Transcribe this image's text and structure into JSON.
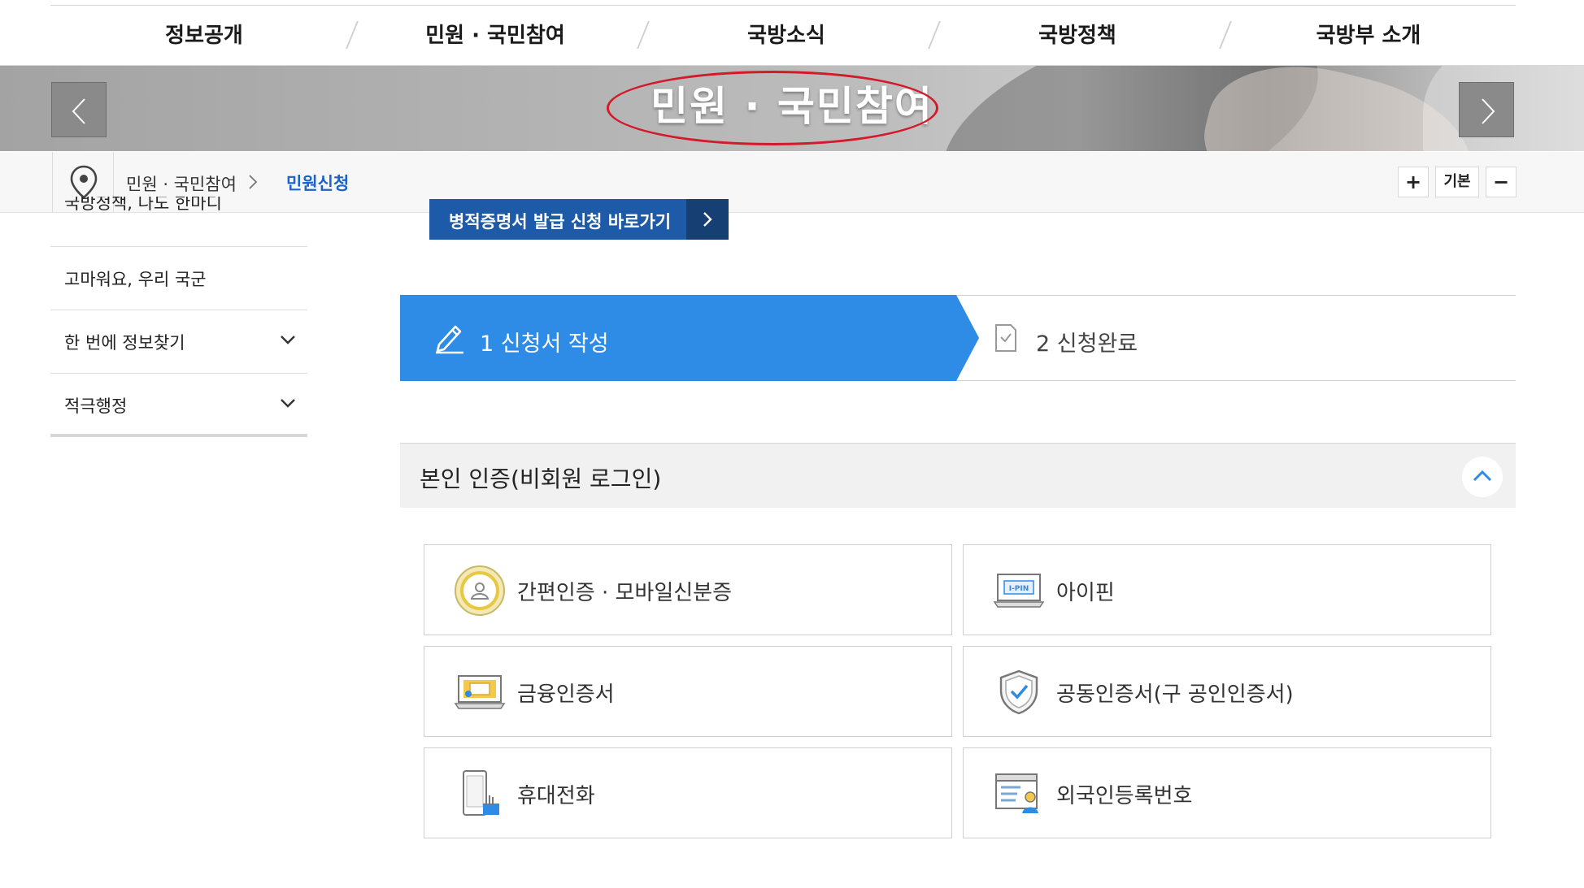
{
  "top_nav": {
    "items": [
      {
        "label": "정보공개"
      },
      {
        "label": "민원 · 국민참여"
      },
      {
        "label": "국방소식"
      },
      {
        "label": "국방정책"
      },
      {
        "label": "국방부 소개"
      }
    ]
  },
  "banner": {
    "title": "민원 · 국민참여",
    "prev_icon": "chevron-left-icon",
    "next_icon": "chevron-right-icon",
    "highlight_color": "#d31a2a"
  },
  "breadcrumb": {
    "home": "민원 · 국민참여",
    "current": "민원신청",
    "zoom_in": "+",
    "zoom_default": "기본",
    "zoom_out": "−",
    "location_icon": "location-pin-icon"
  },
  "side_menu": {
    "items": [
      {
        "label": "국방정책, 나도 한마디"
      },
      {
        "label": "고마워요, 우리 국군"
      },
      {
        "label": "한 번에 정보찾기"
      },
      {
        "label": "적극행정"
      }
    ]
  },
  "shortcut": {
    "label": "병적증명서 발급 신청 바로가기"
  },
  "steps": {
    "step1": "1 신청서 작성",
    "step2": "2 신청완료",
    "active_color": "#2e8ce6"
  },
  "auth": {
    "title": "본인 인증(비회원 로그인)",
    "options": [
      {
        "label": "간편인증 · 모바일신분증",
        "icon": "simple-auth-icon"
      },
      {
        "label": "아이핀",
        "icon": "ipin-icon",
        "icon_text": "I-PIN"
      },
      {
        "label": "금융인증서",
        "icon": "financial-certificate-icon"
      },
      {
        "label": "공동인증서(구 공인인증서)",
        "icon": "joint-certificate-shield-icon"
      },
      {
        "label": "휴대전화",
        "icon": "mobile-phone-icon"
      },
      {
        "label": "외국인등록번호",
        "icon": "alien-registration-icon"
      }
    ]
  }
}
